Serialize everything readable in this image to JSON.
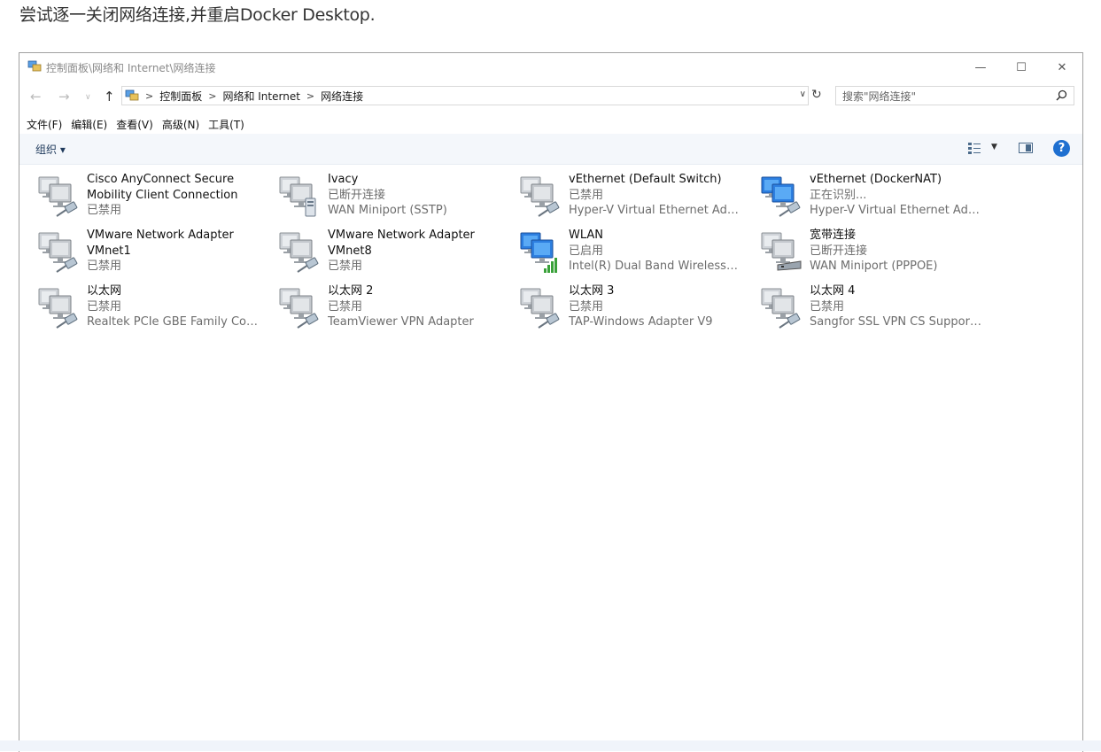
{
  "caption": "尝试逐一关闭网络连接,并重启Docker Desktop.",
  "window": {
    "title": "控制面板\\网络和 Internet\\网络连接",
    "controls": {
      "minimize": "—",
      "maximize": "☐",
      "close": "✕"
    }
  },
  "navigation": {
    "back": "←",
    "forward": "→",
    "recent": "∨",
    "up": "↑",
    "breadcrumb": [
      "控制面板",
      "网络和 Internet",
      "网络连接"
    ],
    "refresh": "↻",
    "search_placeholder": "搜索\"网络连接\""
  },
  "menu": [
    "文件(F)",
    "编辑(E)",
    "查看(V)",
    "高级(N)",
    "工具(T)"
  ],
  "commandbar": {
    "organize": "组织 ▾",
    "help": "?"
  },
  "connections": [
    {
      "name": "Cisco AnyConnect Secure Mobility Client Connection",
      "status": "已禁用",
      "device": "",
      "icon": "wired-disabled"
    },
    {
      "name": "Ivacy",
      "status": "已断开连接",
      "device": "WAN Miniport (SSTP)",
      "icon": "vpn-disconnected"
    },
    {
      "name": "vEthernet (Default Switch)",
      "status": "已禁用",
      "device": "Hyper-V Virtual Ethernet Adap...",
      "icon": "wired-disabled"
    },
    {
      "name": "vEthernet (DockerNAT)",
      "status": "正在识别...",
      "device": "Hyper-V Virtual Ethernet Adap...",
      "icon": "wired-active"
    },
    {
      "name": "VMware Network Adapter VMnet1",
      "status": "已禁用",
      "device": "",
      "icon": "wired-disabled"
    },
    {
      "name": "VMware Network Adapter VMnet8",
      "status": "已禁用",
      "device": "",
      "icon": "wired-disabled"
    },
    {
      "name": "WLAN",
      "status": "已启用",
      "device": "Intel(R) Dual Band Wireless-AC...",
      "icon": "wifi-enabled"
    },
    {
      "name": "宽带连接",
      "status": "已断开连接",
      "device": "WAN Miniport (PPPOE)",
      "icon": "broadband-disconnected"
    },
    {
      "name": "以太网",
      "status": "已禁用",
      "device": "Realtek PCIe GBE Family Contr...",
      "icon": "wired-disabled"
    },
    {
      "name": "以太网 2",
      "status": "已禁用",
      "device": "TeamViewer VPN Adapter",
      "icon": "wired-disabled"
    },
    {
      "name": "以太网 3",
      "status": "已禁用",
      "device": "TAP-Windows Adapter V9",
      "icon": "wired-disabled"
    },
    {
      "name": "以太网 4",
      "status": "已禁用",
      "device": "Sangfor SSL VPN CS Support S...",
      "icon": "wired-disabled"
    }
  ]
}
